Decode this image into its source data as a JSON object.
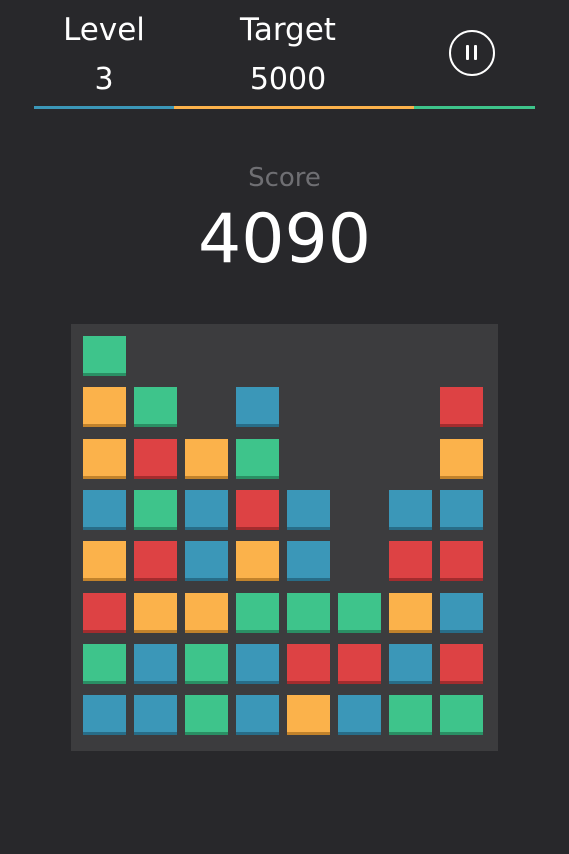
{
  "hud": {
    "level_label": "Level",
    "level_value": "3",
    "target_label": "Target",
    "target_value": "5000",
    "pause_icon": "pause-icon",
    "progress_fraction": 0.818
  },
  "score": {
    "label": "Score",
    "value": "4090"
  },
  "colors": {
    "background": "#28282b",
    "board": "#3c3c3e",
    "green": "#3ec48b",
    "yellow": "#fbb24b",
    "red": "#dd4244",
    "blue": "#3b97b8"
  },
  "board": {
    "columns": 8,
    "rows": 8,
    "grid": [
      [
        "green",
        null,
        null,
        null,
        null,
        null,
        null,
        null
      ],
      [
        "yellow",
        "green",
        null,
        "blue",
        null,
        null,
        null,
        "red"
      ],
      [
        "yellow",
        "red",
        "yellow",
        "green",
        null,
        null,
        null,
        "yellow"
      ],
      [
        "blue",
        "green",
        "blue",
        "red",
        "blue",
        null,
        "blue",
        "blue"
      ],
      [
        "yellow",
        "red",
        "blue",
        "yellow",
        "blue",
        null,
        "red",
        "red"
      ],
      [
        "red",
        "yellow",
        "yellow",
        "green",
        "green",
        "green",
        "yellow",
        "blue"
      ],
      [
        "green",
        "blue",
        "green",
        "blue",
        "red",
        "red",
        "blue",
        "red"
      ],
      [
        "blue",
        "blue",
        "green",
        "blue",
        "yellow",
        "blue",
        "green",
        "green"
      ]
    ]
  }
}
